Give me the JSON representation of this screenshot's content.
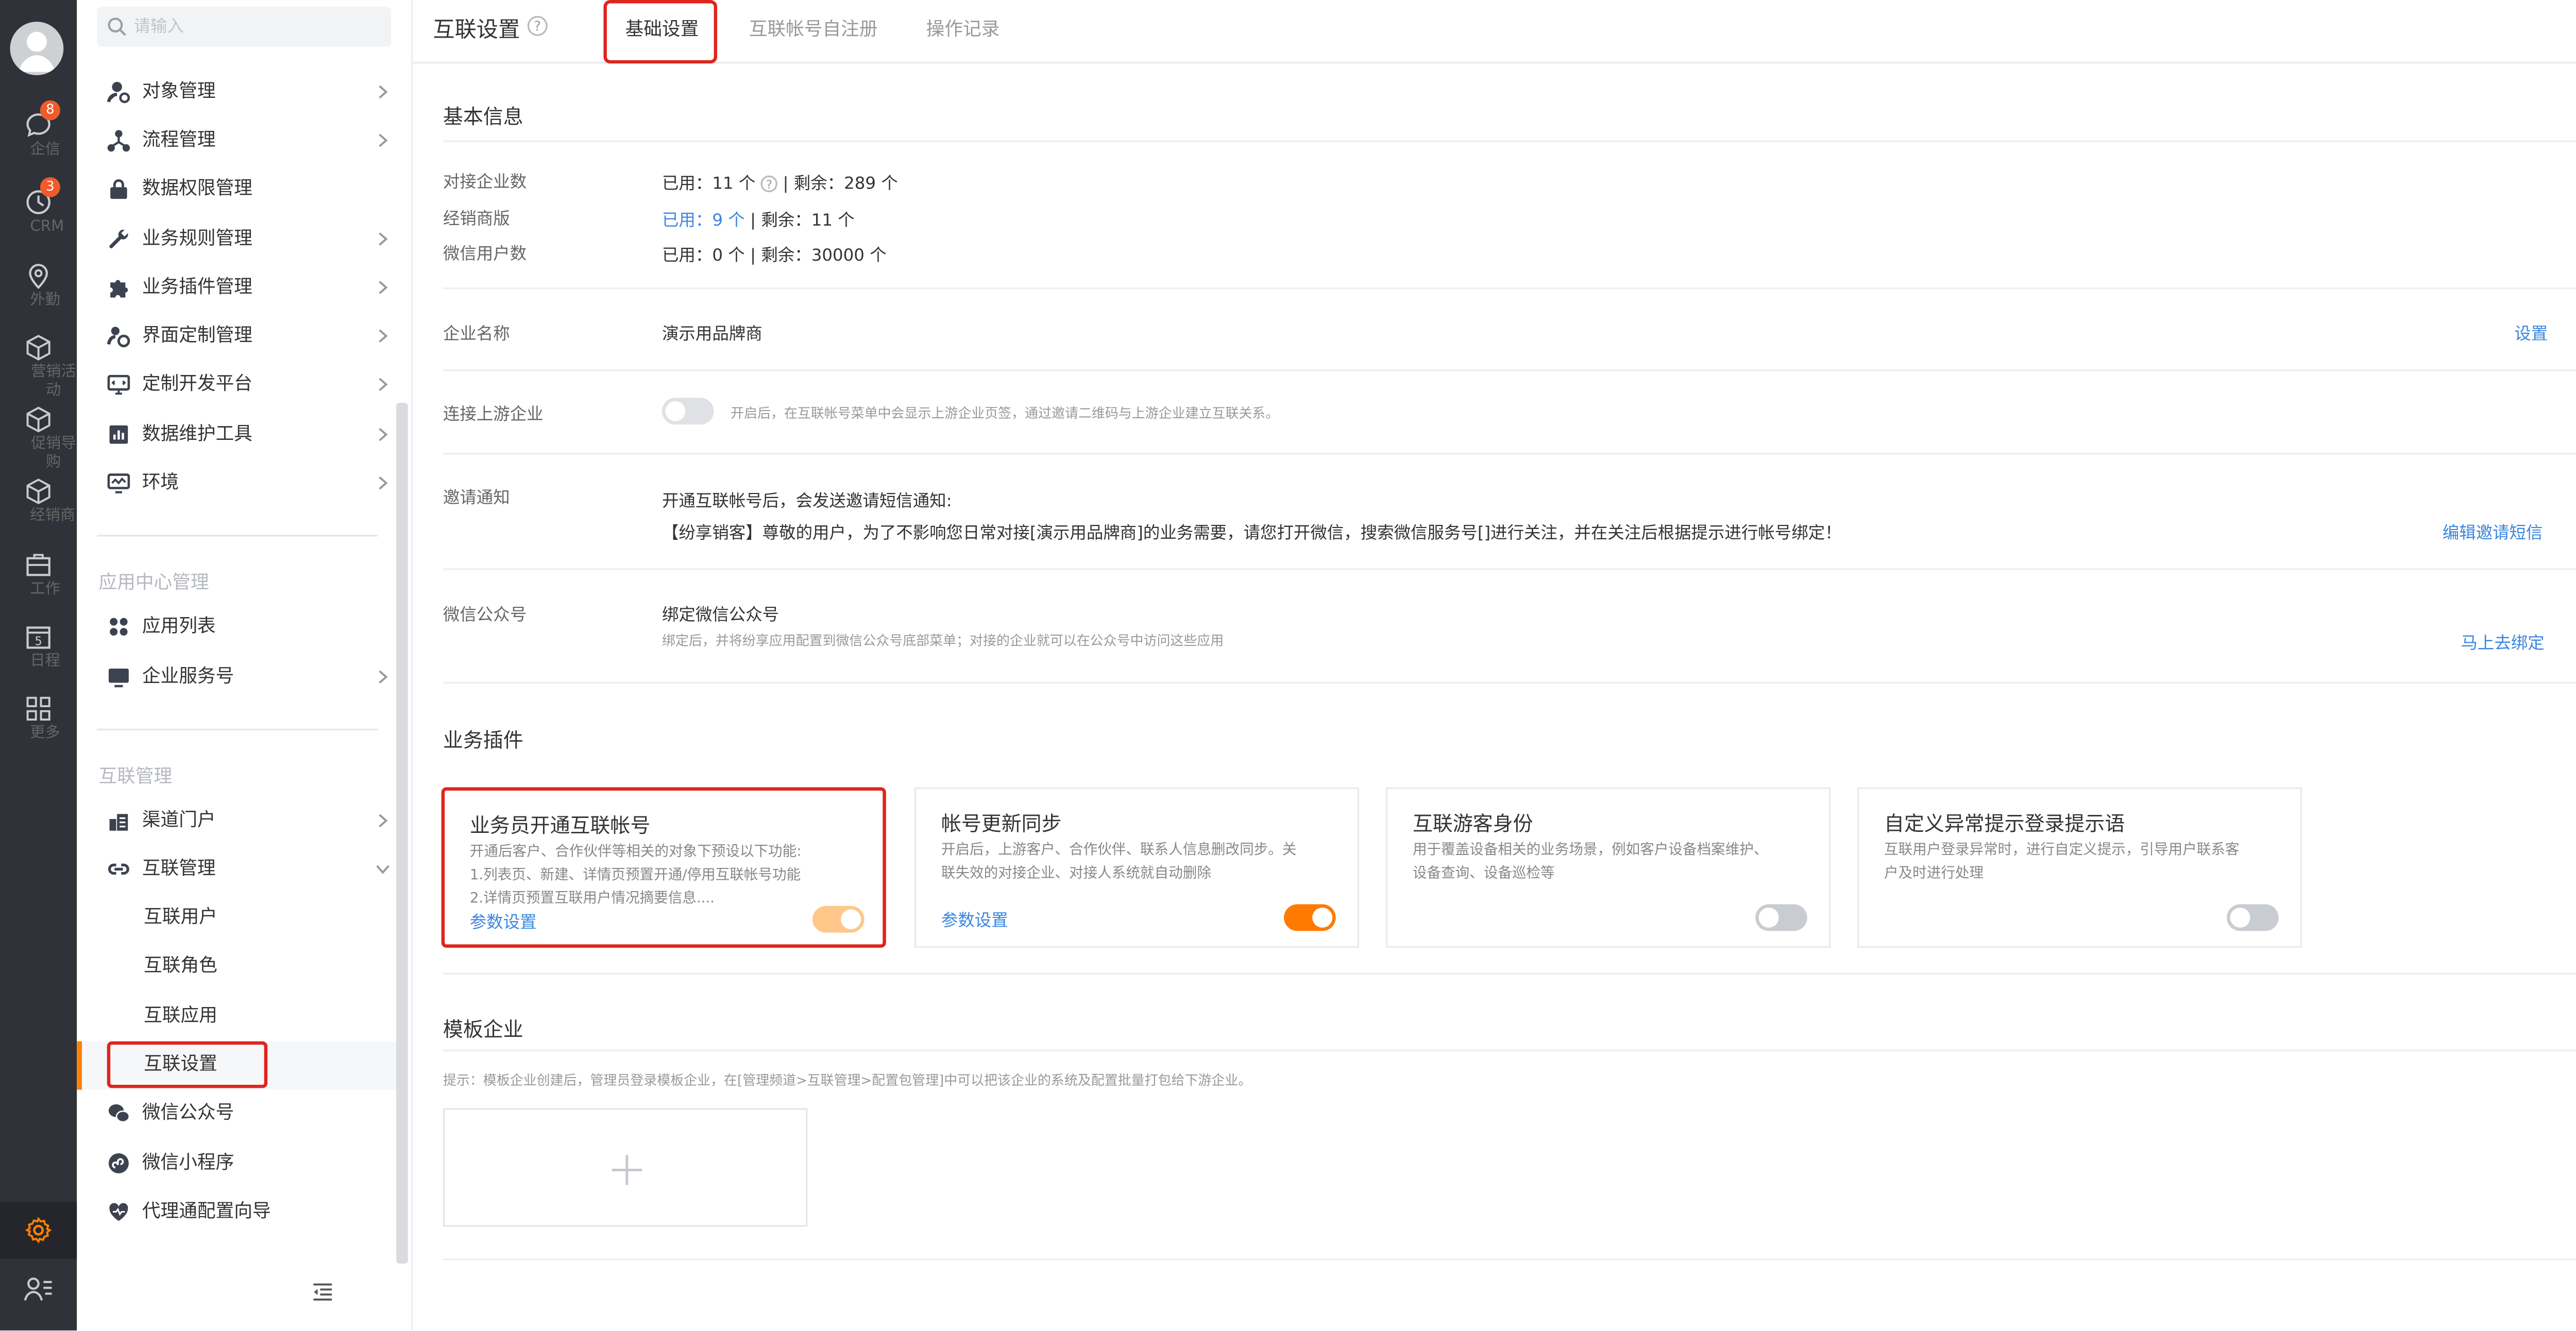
{
  "rail": {
    "items": [
      {
        "label": "企信",
        "badge": "8",
        "icon": "chat-icon"
      },
      {
        "label": "CRM",
        "badge": "3",
        "icon": "clock-icon"
      },
      {
        "label": "外勤",
        "badge": "",
        "icon": "location-icon"
      },
      {
        "label": "营销活动",
        "badge": "",
        "icon": "cube-icon"
      },
      {
        "label": "促销导购",
        "badge": "",
        "icon": "cube-icon"
      },
      {
        "label": "经销商",
        "badge": "",
        "icon": "cube-icon"
      },
      {
        "label": "工作",
        "badge": "",
        "icon": "briefcase-icon"
      },
      {
        "label": "日程",
        "badge": "",
        "icon": "calendar-icon",
        "day": "5"
      },
      {
        "label": "更多",
        "badge": "",
        "icon": "grid-icon"
      }
    ]
  },
  "nav": {
    "search_placeholder": "请输入",
    "items": [
      {
        "label": "对象管理",
        "arrow": true,
        "icon": "object-icon"
      },
      {
        "label": "流程管理",
        "arrow": true,
        "icon": "flow-icon"
      },
      {
        "label": "数据权限管理",
        "arrow": false,
        "icon": "lock-icon"
      },
      {
        "label": "业务规则管理",
        "arrow": true,
        "icon": "wrench-icon"
      },
      {
        "label": "业务插件管理",
        "arrow": true,
        "icon": "puzzle-icon"
      },
      {
        "label": "界面定制管理",
        "arrow": true,
        "icon": "ui-custom-icon"
      },
      {
        "label": "定制开发平台",
        "arrow": true,
        "icon": "dev-platform-icon"
      },
      {
        "label": "数据维护工具",
        "arrow": true,
        "icon": "chart-icon"
      },
      {
        "label": "环境",
        "arrow": true,
        "icon": "env-icon"
      }
    ],
    "group_app": "应用中心管理",
    "app_items": [
      {
        "label": "应用列表",
        "arrow": false,
        "icon": "apps-icon"
      },
      {
        "label": "企业服务号",
        "arrow": true,
        "icon": "monitor-icon"
      }
    ],
    "group_interconnect": "互联管理",
    "inter_items": [
      {
        "label": "渠道门户",
        "arrow": true,
        "icon": "portal-icon"
      },
      {
        "label": "互联管理",
        "arrow": true,
        "icon": "link-icon"
      }
    ],
    "sub_items": [
      "互联用户",
      "互联角色",
      "互联应用",
      "互联设置"
    ],
    "tail_items": [
      {
        "label": "微信公众号",
        "icon": "wechat-icon"
      },
      {
        "label": "微信小程序",
        "icon": "miniprogram-icon"
      },
      {
        "label": "代理通配置向导",
        "icon": "heart-icon"
      }
    ]
  },
  "header": {
    "title": "互联设置",
    "tabs": [
      "基础设置",
      "互联帐号自注册",
      "操作记录"
    ]
  },
  "basic": {
    "section_title": "基本信息",
    "rows": [
      {
        "label": "对接企业数",
        "used_prefix": "已用：",
        "used_value": "11 个",
        "sep": " | 剩余：",
        "remain": "289 个"
      },
      {
        "label": "经销商版",
        "used_prefix": "已用：",
        "used_value": "9 个",
        "sep": " | 剩余：",
        "remain": "11 个"
      },
      {
        "label": "微信用户数",
        "used_prefix": "已用：",
        "used_value": "0 个",
        "sep": " | 剩余：",
        "remain": "30000 个"
      }
    ],
    "company_label": "企业名称",
    "company_value": "演示用品牌商",
    "company_action": "设置",
    "upstream_label": "连接上游企业",
    "upstream_enabled": false,
    "upstream_hint": "开启后，在互联帐号菜单中会显示上游企业页签，通过邀请二维码与上游企业建立互联关系。",
    "invite_label": "邀请通知",
    "invite_line1": "开通互联帐号后，会发送邀请短信通知:",
    "invite_line2": "【纷享销客】尊敬的用户，为了不影响您日常对接[演示用品牌商]的业务需要，请您打开微信，搜索微信服务号[]进行关注，并在关注后根据提示进行帐号绑定！",
    "invite_action": "编辑邀请短信",
    "wechat_label": "微信公众号",
    "wechat_title": "绑定微信公众号",
    "wechat_hint": "绑定后，并将纷享应用配置到微信公众号底部菜单；对接的企业就可以在公众号中访问这些应用",
    "wechat_action": "马上去绑定"
  },
  "plugins": {
    "section_title": "业务插件",
    "cards": [
      {
        "title": "业务员开通互联帐号",
        "desc": [
          "开通后客户、合作伙伴等相关的对象下预设以下功能:",
          "1.列表页、新建、详情页预置开通/停用互联帐号功能",
          "2.详情页预置互联用户情况摘要信息...."
        ],
        "link": "参数设置",
        "enabled": true,
        "highlight": true
      },
      {
        "title": "帐号更新同步",
        "desc": [
          "开启后，上游客户、合作伙伴、联系人信息删改同步。关",
          "联失效的对接企业、对接人系统就自动删除"
        ],
        "link": "参数设置",
        "enabled": true,
        "highlight": false
      },
      {
        "title": "互联游客身份",
        "desc": [
          "用于覆盖设备相关的业务场景，例如客户设备档案维护、",
          "设备查询、设备巡检等"
        ],
        "link": "",
        "enabled": false,
        "highlight": false
      },
      {
        "title": "自定义异常提示登录提示语",
        "desc": [
          "互联用户登录异常时，进行自定义提示，引导用户联系客",
          "户及时进行处理"
        ],
        "link": "",
        "enabled": false,
        "highlight": false
      }
    ]
  },
  "template": {
    "section_title": "模板企业",
    "hint": "提示：模板企业创建后，管理员登录模板企业，在[管理频道>互联管理>配置包管理]中可以把该企业的系统及配置批量打包给下游企业。"
  },
  "colors": {
    "accent": "#ff7a00",
    "link": "#3b86e0",
    "highlight": "#e0251d",
    "rail": "#2f3239"
  }
}
